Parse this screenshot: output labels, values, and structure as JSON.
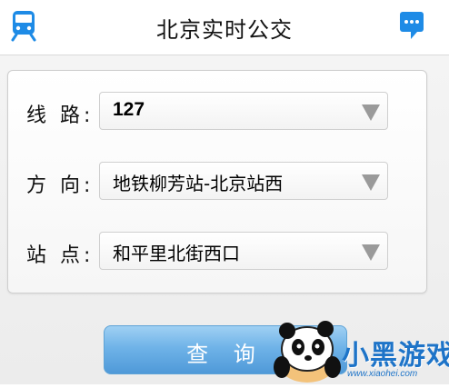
{
  "header": {
    "title": "北京实时公交",
    "left_icon": "train-icon",
    "right_icon": "chat-icon",
    "accent_color": "#1e8be6"
  },
  "form": {
    "rows": [
      {
        "label": "线 路:",
        "value": "127"
      },
      {
        "label": "方 向:",
        "value": "地铁柳芳站-北京站西"
      },
      {
        "label": "站 点:",
        "value": "和平里北街西口"
      }
    ]
  },
  "actions": {
    "query_label": "查 询",
    "button_color": "#6fb3e8"
  },
  "watermark": {
    "text": "小黑游戏",
    "url": "www.xiaohei.com"
  }
}
